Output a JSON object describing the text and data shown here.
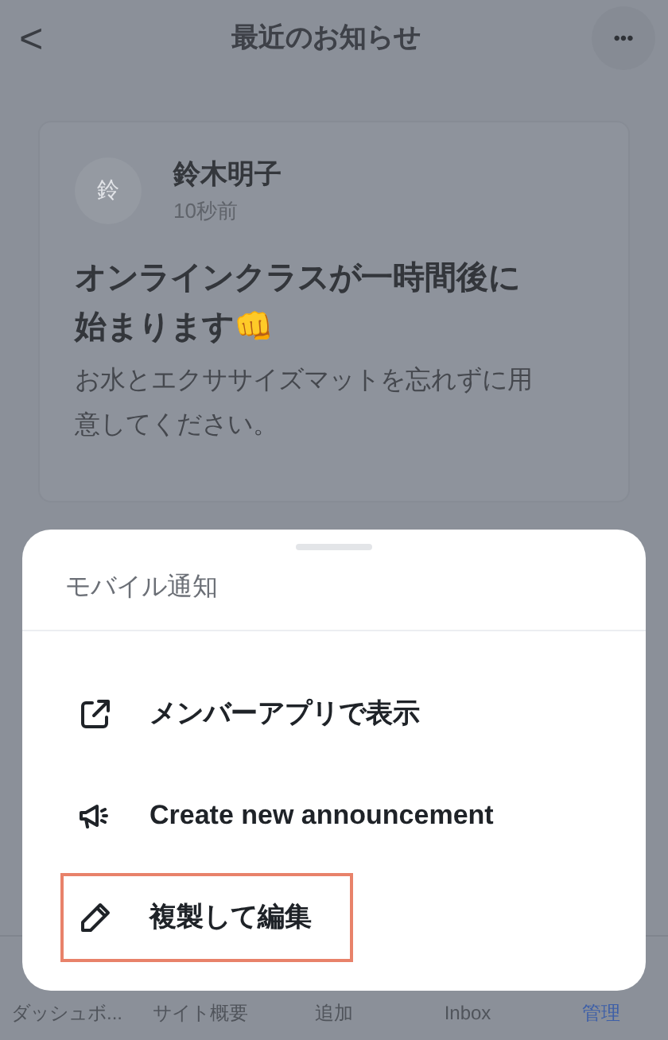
{
  "header": {
    "back": "<",
    "title": "最近のお知らせ",
    "more": "•••"
  },
  "announcement": {
    "avatar_initial": "鈴",
    "author": "鈴木明子",
    "time": "10秒前",
    "title": "オンラインクラスが一時間後に始まります👊",
    "body": "お水とエクササイズマットを忘れずに用意してください。"
  },
  "tab_bar": [
    {
      "label": "ダッシュボ...",
      "selected": false
    },
    {
      "label": "サイト概要",
      "selected": false
    },
    {
      "label": "追加",
      "selected": false
    },
    {
      "label": "Inbox",
      "selected": false
    },
    {
      "label": "管理",
      "selected": true
    }
  ],
  "sheet": {
    "title": "モバイル通知",
    "items": [
      {
        "kind": "external",
        "label": "メンバーアプリで表示",
        "highlighted": false
      },
      {
        "kind": "megaphone",
        "label": "Create new announcement",
        "highlighted": false
      },
      {
        "kind": "pencil",
        "label": "複製して編集",
        "highlighted": true
      }
    ]
  }
}
